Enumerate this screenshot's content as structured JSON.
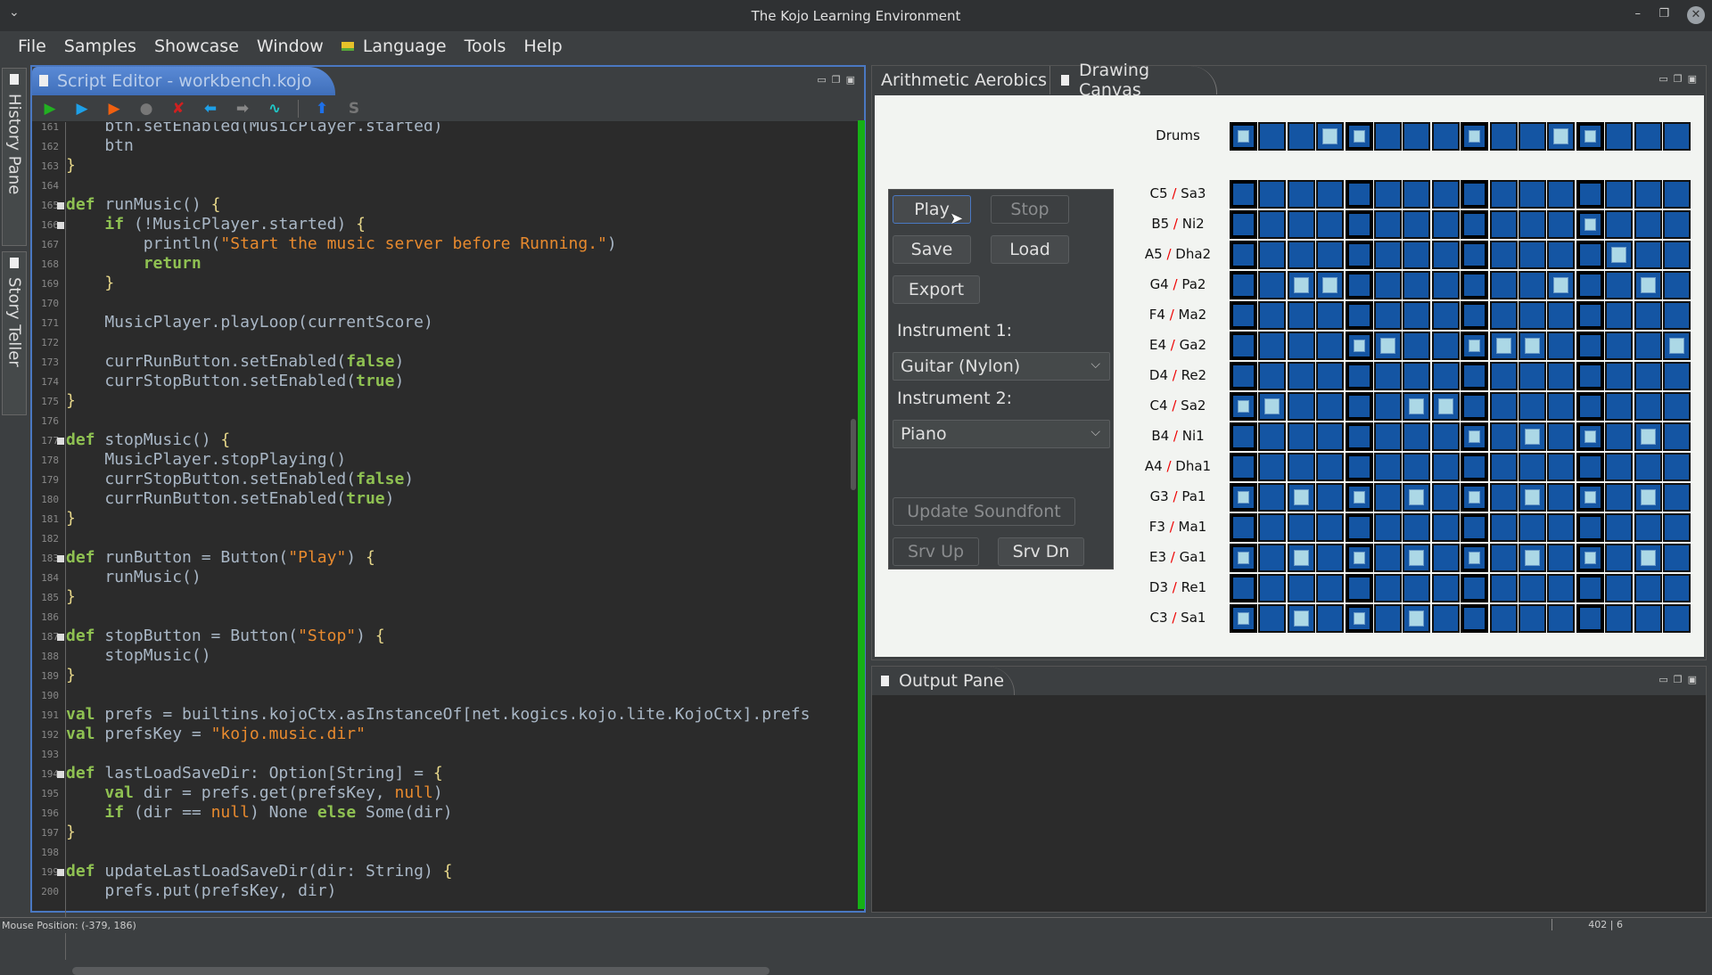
{
  "window": {
    "title": "The Kojo Learning Environment"
  },
  "menu": [
    "File",
    "Samples",
    "Showcase",
    "Window",
    "Language",
    "Tools",
    "Help"
  ],
  "side_tabs": [
    "History Pane",
    "Story Teller"
  ],
  "editor": {
    "tab": "Script Editor - workbench.kojo",
    "toolbar": [
      {
        "icon": "run-icon",
        "glyph": "▶",
        "color": "#22b022"
      },
      {
        "icon": "run-worksheet-icon",
        "glyph": "▶",
        "color": "#1ea0e8"
      },
      {
        "icon": "trace-icon",
        "glyph": "▶",
        "color": "#f06010"
      },
      {
        "icon": "stop-icon",
        "glyph": "●",
        "color": "#777777"
      },
      {
        "icon": "check-icon",
        "glyph": "✘",
        "color": "#d02020"
      },
      {
        "icon": "history-back-icon",
        "glyph": "⬅",
        "color": "#1ea0e8"
      },
      {
        "icon": "history-forward-icon",
        "glyph": "➡",
        "color": "#888888"
      },
      {
        "icon": "format-icon",
        "glyph": "∿",
        "color": "#20c8c8"
      },
      {
        "icon": "upload-icon",
        "glyph": "⬆",
        "color": "#1e70e8"
      },
      {
        "icon": "clear-icon",
        "glyph": "S",
        "color": "#777777"
      }
    ],
    "lines": [
      {
        "n": 161,
        "t": [
          [
            "t",
            "    btn.setEnabled(MusicPlayer.started)"
          ]
        ]
      },
      {
        "n": 162,
        "t": [
          [
            "t",
            "    btn"
          ]
        ]
      },
      {
        "n": 163,
        "t": [
          [
            "b",
            "}"
          ]
        ]
      },
      {
        "n": 164,
        "t": []
      },
      {
        "n": 165,
        "fold": true,
        "t": [
          [
            "k",
            "def"
          ],
          [
            "t",
            " runMusic() "
          ],
          [
            "b",
            "{"
          ]
        ]
      },
      {
        "n": 166,
        "fold": true,
        "t": [
          [
            "t",
            "    "
          ],
          [
            "k",
            "if"
          ],
          [
            "t",
            " (!MusicPlayer.started) "
          ],
          [
            "b",
            "{"
          ]
        ]
      },
      {
        "n": 167,
        "t": [
          [
            "t",
            "        println("
          ],
          [
            "s",
            "\"Start the music server before Running.\""
          ],
          [
            "t",
            ")"
          ]
        ]
      },
      {
        "n": 168,
        "t": [
          [
            "t",
            "        "
          ],
          [
            "k",
            "return"
          ]
        ]
      },
      {
        "n": 169,
        "t": [
          [
            "t",
            "    "
          ],
          [
            "b",
            "}"
          ]
        ]
      },
      {
        "n": 170,
        "t": []
      },
      {
        "n": 171,
        "t": [
          [
            "t",
            "    MusicPlayer.playLoop(currentScore)"
          ]
        ]
      },
      {
        "n": 172,
        "t": []
      },
      {
        "n": 173,
        "t": [
          [
            "t",
            "    currRunButton.setEnabled("
          ],
          [
            "k",
            "false"
          ],
          [
            "t",
            ")"
          ]
        ]
      },
      {
        "n": 174,
        "t": [
          [
            "t",
            "    currStopButton.setEnabled("
          ],
          [
            "k",
            "true"
          ],
          [
            "t",
            ")"
          ]
        ]
      },
      {
        "n": 175,
        "t": [
          [
            "b",
            "}"
          ]
        ]
      },
      {
        "n": 176,
        "t": []
      },
      {
        "n": 177,
        "fold": true,
        "t": [
          [
            "k",
            "def"
          ],
          [
            "t",
            " stopMusic() "
          ],
          [
            "b",
            "{"
          ]
        ]
      },
      {
        "n": 178,
        "t": [
          [
            "t",
            "    MusicPlayer.stopPlaying()"
          ]
        ]
      },
      {
        "n": 179,
        "t": [
          [
            "t",
            "    currStopButton.setEnabled("
          ],
          [
            "k",
            "false"
          ],
          [
            "t",
            ")"
          ]
        ]
      },
      {
        "n": 180,
        "t": [
          [
            "t",
            "    currRunButton.setEnabled("
          ],
          [
            "k",
            "true"
          ],
          [
            "t",
            ")"
          ]
        ]
      },
      {
        "n": 181,
        "t": [
          [
            "b",
            "}"
          ]
        ]
      },
      {
        "n": 182,
        "t": []
      },
      {
        "n": 183,
        "fold": true,
        "t": [
          [
            "k",
            "def"
          ],
          [
            "t",
            " runButton = Button("
          ],
          [
            "s",
            "\"Play\""
          ],
          [
            "t",
            ") "
          ],
          [
            "b",
            "{"
          ]
        ]
      },
      {
        "n": 184,
        "t": [
          [
            "t",
            "    runMusic()"
          ]
        ]
      },
      {
        "n": 185,
        "t": [
          [
            "b",
            "}"
          ]
        ]
      },
      {
        "n": 186,
        "t": []
      },
      {
        "n": 187,
        "fold": true,
        "t": [
          [
            "k",
            "def"
          ],
          [
            "t",
            " stopButton = Button("
          ],
          [
            "s",
            "\"Stop\""
          ],
          [
            "t",
            ") "
          ],
          [
            "b",
            "{"
          ]
        ]
      },
      {
        "n": 188,
        "t": [
          [
            "t",
            "    stopMusic()"
          ]
        ]
      },
      {
        "n": 189,
        "t": [
          [
            "b",
            "}"
          ]
        ]
      },
      {
        "n": 190,
        "t": []
      },
      {
        "n": 191,
        "t": [
          [
            "k",
            "val"
          ],
          [
            "t",
            " prefs = builtins.kojoCtx.asInstanceOf[net.kogics.kojo.lite.KojoCtx].prefs"
          ]
        ]
      },
      {
        "n": 192,
        "t": [
          [
            "k",
            "val"
          ],
          [
            "t",
            " prefsKey = "
          ],
          [
            "s",
            "\"kojo.music.dir\""
          ]
        ]
      },
      {
        "n": 193,
        "t": []
      },
      {
        "n": 194,
        "fold": true,
        "t": [
          [
            "k",
            "def"
          ],
          [
            "t",
            " lastLoadSaveDir: Option[String] = "
          ],
          [
            "b",
            "{"
          ]
        ]
      },
      {
        "n": 195,
        "t": [
          [
            "t",
            "    "
          ],
          [
            "k",
            "val"
          ],
          [
            "t",
            " dir = prefs.get(prefsKey, "
          ],
          [
            "n",
            "null"
          ],
          [
            "t",
            ")"
          ]
        ]
      },
      {
        "n": 196,
        "t": [
          [
            "t",
            "    "
          ],
          [
            "k",
            "if"
          ],
          [
            "t",
            " (dir == "
          ],
          [
            "n",
            "null"
          ],
          [
            "t",
            ") None "
          ],
          [
            "k",
            "else"
          ],
          [
            "t",
            " Some(dir)"
          ]
        ]
      },
      {
        "n": 197,
        "t": [
          [
            "b",
            "}"
          ]
        ]
      },
      {
        "n": 198,
        "t": []
      },
      {
        "n": 199,
        "fold": true,
        "t": [
          [
            "k",
            "def"
          ],
          [
            "t",
            " updateLastLoadSaveDir(dir: String) "
          ],
          [
            "b",
            "{"
          ]
        ]
      },
      {
        "n": 200,
        "t": [
          [
            "t",
            "    prefs.put(prefsKey, dir)"
          ]
        ]
      }
    ]
  },
  "right_tabs": [
    "Arithmetic Aerobics",
    "Drawing Canvas"
  ],
  "controls": {
    "play": "Play",
    "stop": "Stop",
    "save": "Save",
    "load": "Load",
    "export": "Export",
    "instrument1_label": "Instrument 1:",
    "instrument1_value": "Guitar (Nylon)",
    "instrument2_label": "Instrument 2:",
    "instrument2_value": "Piano",
    "update_soundfont": "Update Soundfont",
    "srv_up": "Srv Up",
    "srv_dn": "Srv Dn"
  },
  "grid": {
    "columns": 16,
    "beat_columns": [
      1,
      5,
      9,
      13
    ],
    "cell_color": "#1455a3",
    "active_color": "#acd8e6",
    "drums": {
      "label": "Drums",
      "active": [
        1,
        4,
        5,
        9,
        12,
        13
      ]
    },
    "rows": [
      {
        "western": "C5",
        "indian": "Sa3",
        "active": []
      },
      {
        "western": "B5",
        "indian": "Ni2",
        "active": [
          13
        ]
      },
      {
        "western": "A5",
        "indian": "Dha2",
        "active": [
          14
        ]
      },
      {
        "western": "G4",
        "indian": "Pa2",
        "active": [
          3,
          4,
          12,
          15
        ]
      },
      {
        "western": "F4",
        "indian": "Ma2",
        "active": []
      },
      {
        "western": "E4",
        "indian": "Ga2",
        "active": [
          5,
          6,
          9,
          10,
          11,
          16
        ]
      },
      {
        "western": "D4",
        "indian": "Re2",
        "active": []
      },
      {
        "western": "C4",
        "indian": "Sa2",
        "active": [
          1,
          2,
          7,
          8
        ]
      },
      {
        "western": "B4",
        "indian": "Ni1",
        "active": [
          9,
          11,
          13,
          15
        ]
      },
      {
        "western": "A4",
        "indian": "Dha1",
        "active": []
      },
      {
        "western": "G3",
        "indian": "Pa1",
        "active": [
          1,
          3,
          5,
          7,
          9,
          11,
          13,
          15
        ]
      },
      {
        "western": "F3",
        "indian": "Ma1",
        "active": []
      },
      {
        "western": "E3",
        "indian": "Ga1",
        "active": [
          1,
          3,
          5,
          7,
          9,
          11,
          13,
          15
        ]
      },
      {
        "western": "D3",
        "indian": "Re1",
        "active": []
      },
      {
        "western": "C3",
        "indian": "Sa1",
        "active": [
          1,
          3,
          5,
          7
        ]
      }
    ]
  },
  "output": {
    "tab": "Output Pane"
  },
  "status": {
    "mouse": "Mouse Position: (-379, 186)",
    "cursor": "402 | 6"
  }
}
